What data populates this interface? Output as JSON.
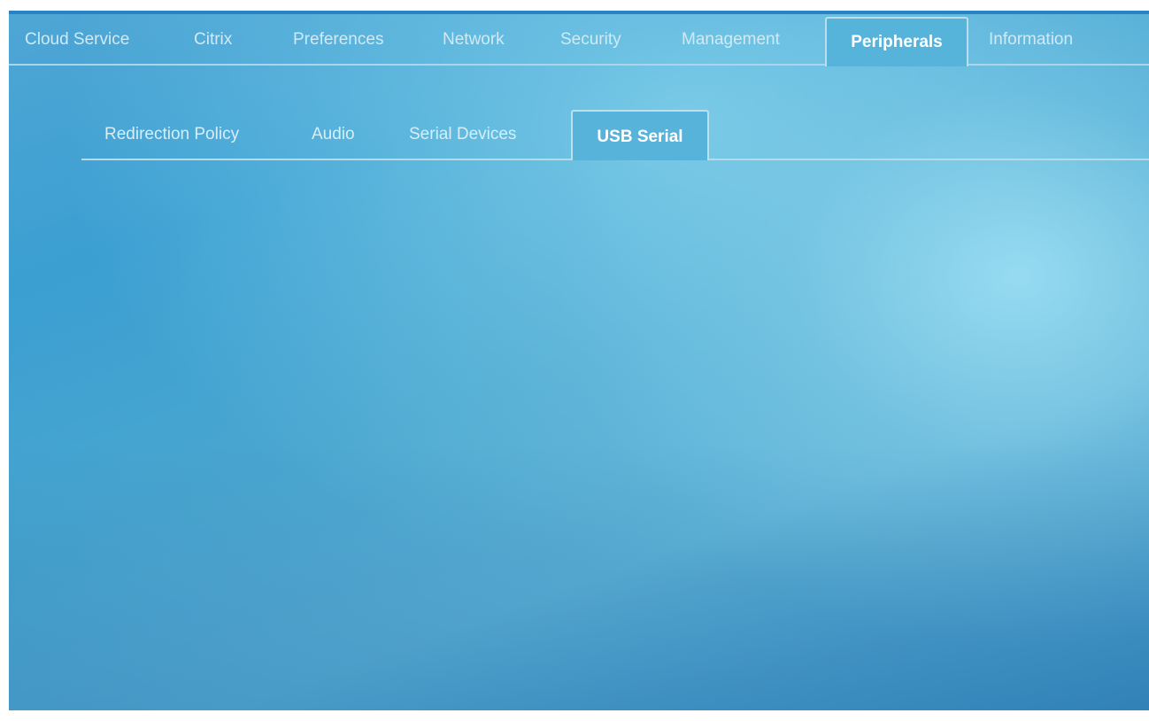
{
  "top_tabs": [
    {
      "label": "Cloud Service"
    },
    {
      "label": "Citrix"
    },
    {
      "label": "Preferences"
    },
    {
      "label": "Network"
    },
    {
      "label": "Security"
    },
    {
      "label": "Management"
    },
    {
      "label": "Peripherals",
      "active": true
    },
    {
      "label": "Information"
    }
  ],
  "sub_tabs": [
    {
      "label": "Redirection Policy"
    },
    {
      "label": "Audio"
    },
    {
      "label": "Serial Devices"
    },
    {
      "label": "USB Serial",
      "active": true
    }
  ],
  "colors": {
    "accent_border": "#2a82c4",
    "active_tab_bg": "#56b3da",
    "inactive_tab_text": "#cfeaf6",
    "active_tab_text": "#ffffff"
  }
}
